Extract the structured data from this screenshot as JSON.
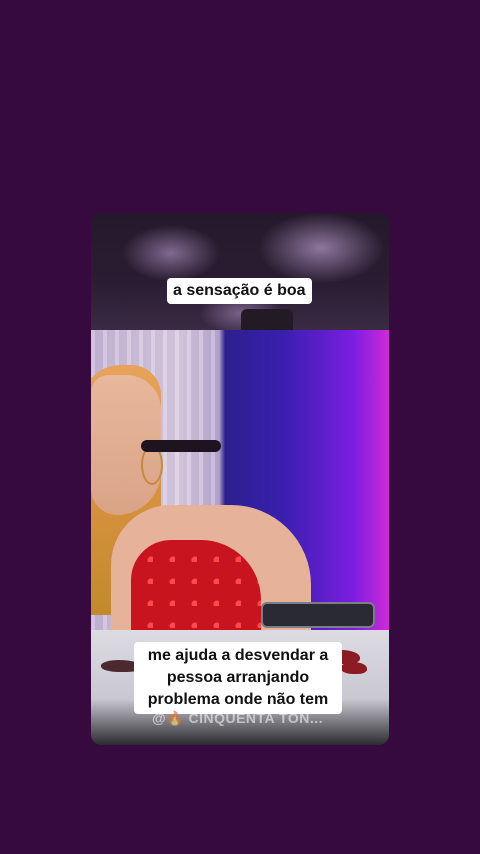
{
  "colors": {
    "background": "#36093f",
    "caption_bg": "#ffffff",
    "caption_text": "#111111"
  },
  "captions": {
    "top": "a sensação é boa",
    "bottom_lines": [
      "me ajuda a desvendar a",
      "pessoa arranjando",
      "problema onde não tem"
    ]
  },
  "watermark": {
    "text": "@🔥 CINQUENTA TON..."
  }
}
